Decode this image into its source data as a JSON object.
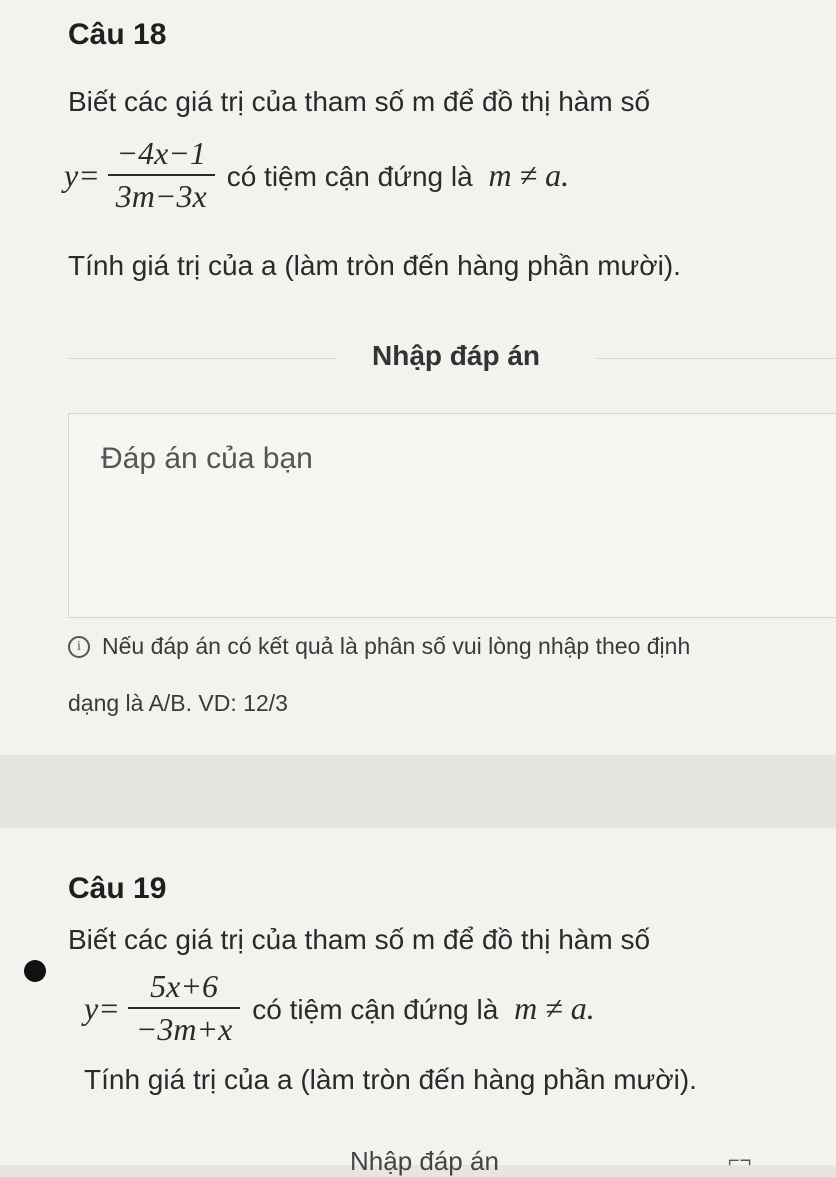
{
  "q18": {
    "title": "Câu 18",
    "line1": "Biết các giá trị của tham số m để đồ thị hàm số",
    "lhs": "y=",
    "numerator": "−4x−1",
    "denominator": "3m−3x",
    "tail_text": "có tiệm cận đứng là",
    "condition": "m ≠ a.",
    "line3": "Tính giá trị của a (làm tròn đến hàng phần mười)."
  },
  "entry_label": "Nhập đáp án",
  "answer": {
    "placeholder": "Đáp án của bạn"
  },
  "hint": {
    "line1": "Nếu đáp án có kết quả là phân số vui lòng nhập theo định",
    "line2": "dạng là A/B. VD: 12/3"
  },
  "q19": {
    "title": "Câu 19",
    "line1": "Biết các giá trị của tham số m để đồ thị hàm số",
    "lhs": "y=",
    "numerator": "5x+6",
    "denominator": "−3m+x",
    "tail_text": "có tiệm cận đứng là",
    "condition": "m ≠ a.",
    "line3": "Tính giá trị của a (làm tròn đến hàng phần mười)."
  },
  "bottom_entry_label": "Nhập đáp án",
  "colors": {
    "background": "#e7e5e0",
    "card": "#f3f2ee"
  }
}
